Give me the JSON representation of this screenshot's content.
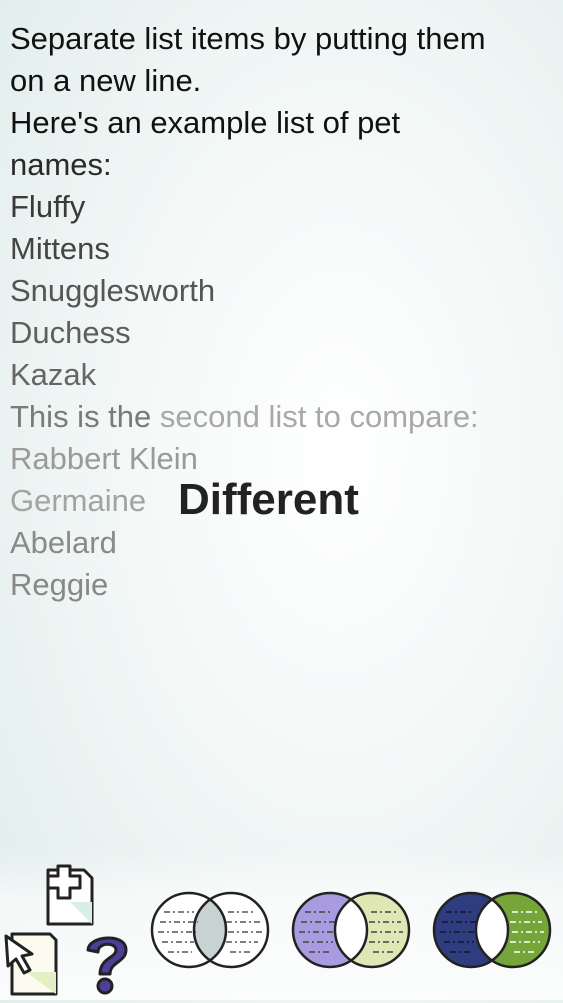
{
  "editor": {
    "lines": [
      {
        "text": "Separate list items by putting them",
        "color": "#111111"
      },
      {
        "text": "on a new line.",
        "color": "#111111"
      },
      {
        "text": "Here's an example list of pet",
        "color": "#111111"
      },
      {
        "text": "names:",
        "color": "#2a2a2a"
      },
      {
        "text": "Fluffy",
        "color": "#3a3a3a"
      },
      {
        "text": "Mittens",
        "color": "#454545"
      },
      {
        "text": "Snugglesworth",
        "color": "#555555"
      },
      {
        "text": "Duchess",
        "color": "#5e5e5e"
      },
      {
        "text": "Kazak",
        "color": "#666666"
      },
      {
        "text": "This is the",
        "color": "#7a7a7a"
      },
      {
        "text": "Rabbert Klein",
        "color": "#9a9a9a"
      },
      {
        "text": "Germaine",
        "color": "#a3a3a3"
      },
      {
        "text": "Abelard",
        "color": "#8a8a8a"
      },
      {
        "text": "Reggie",
        "color": "#888888"
      }
    ],
    "line9_tail": "second list to compare:",
    "result_label": "Different"
  },
  "toolbar": {
    "add_icon": "plus-document-icon",
    "select_icon": "pointer-document-icon",
    "help_icon": "question-mark-icon",
    "venn_buttons": [
      {
        "name": "venn-intersection-button",
        "left_fill": "#ffffff",
        "right_fill": "#ffffff",
        "overlap_fill": "#c9d2d2"
      },
      {
        "name": "venn-difference-button",
        "left_fill": "#a99be0",
        "right_fill": "#dfe7b4",
        "overlap_fill": "#ffffff"
      },
      {
        "name": "venn-union-button",
        "left_fill": "#2f3d7e",
        "right_fill": "#76a63a",
        "overlap_fill": "#ffffff"
      }
    ],
    "colors": {
      "help_purple": "#4b3f9a",
      "outline": "#222222"
    }
  }
}
